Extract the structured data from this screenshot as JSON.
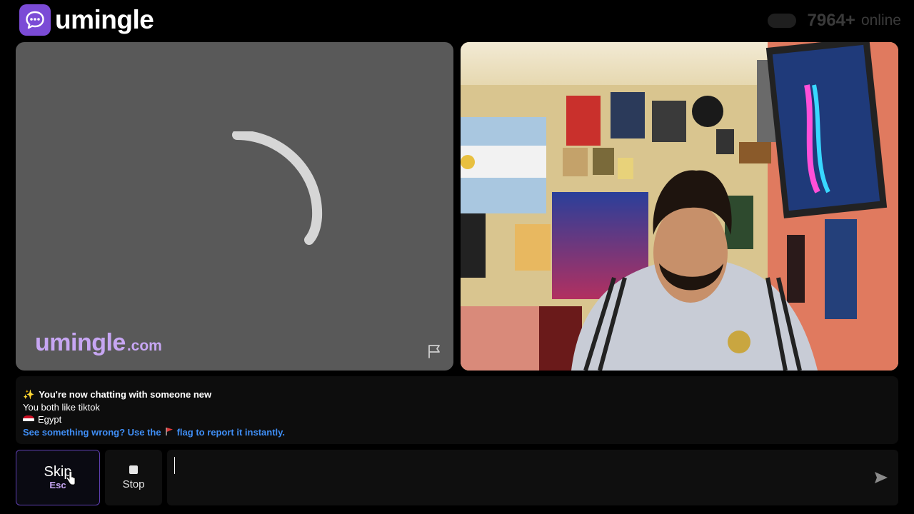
{
  "header": {
    "logo_text": "umingle",
    "online_count": "7964+",
    "online_label": "online"
  },
  "stranger_video": {
    "watermark_main": "umingle",
    "watermark_suffix": ".com"
  },
  "chat_log": {
    "line1": "You're now chatting with someone new",
    "line2": "You both like tiktok",
    "country": "Egypt",
    "report_prefix": "See something wrong? Use the",
    "report_suffix": "flag to report it instantly."
  },
  "controls": {
    "skip_label": "Skip",
    "skip_key": "Esc",
    "stop_label": "Stop",
    "message_value": ""
  },
  "colors": {
    "brand": "#7b4bd6",
    "watermark": "#c7a6f3",
    "link": "#3f8ef5"
  },
  "icons": {
    "logo": "chat-bubble-icon",
    "report": "flag-icon",
    "send": "send-icon",
    "stop": "stop-square-icon"
  }
}
